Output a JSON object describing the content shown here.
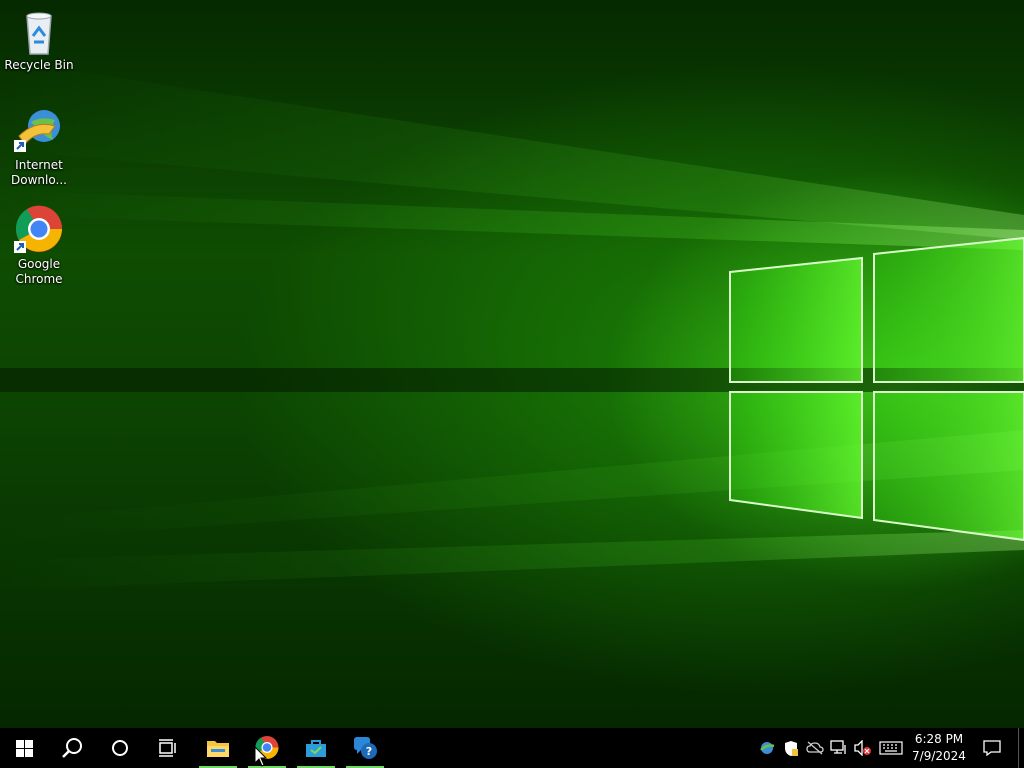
{
  "desktop": {
    "icons": [
      {
        "label": "Recycle Bin",
        "icon": "recycle-bin-icon"
      },
      {
        "label": "Internet Downlo...",
        "icon": "internet-download-manager-icon"
      },
      {
        "label": "Google Chrome",
        "icon": "chrome-icon"
      }
    ]
  },
  "taskbar": {
    "start": "windows-start-icon",
    "search": "search-icon",
    "cortana": "cortana-icon",
    "task_view": "task-view-icon",
    "apps": [
      {
        "name": "File Explorer",
        "icon": "file-explorer-icon"
      },
      {
        "name": "Google Chrome",
        "icon": "chrome-icon"
      },
      {
        "name": "Store",
        "icon": "store-icon"
      },
      {
        "name": "Get Help",
        "icon": "get-help-icon"
      }
    ],
    "tray": [
      "network-globe-icon",
      "security-shield-icon",
      "onedrive-offline-icon",
      "network-icon",
      "volume-muted-icon",
      "keyboard-icon"
    ],
    "clock": {
      "time": "6:28 PM",
      "date": "7/9/2024"
    },
    "notification": "action-center-icon"
  },
  "colors": {
    "accent_underline": "#6fd860",
    "wallpaper_green": "#3fe01a",
    "taskbar": "#000000"
  }
}
